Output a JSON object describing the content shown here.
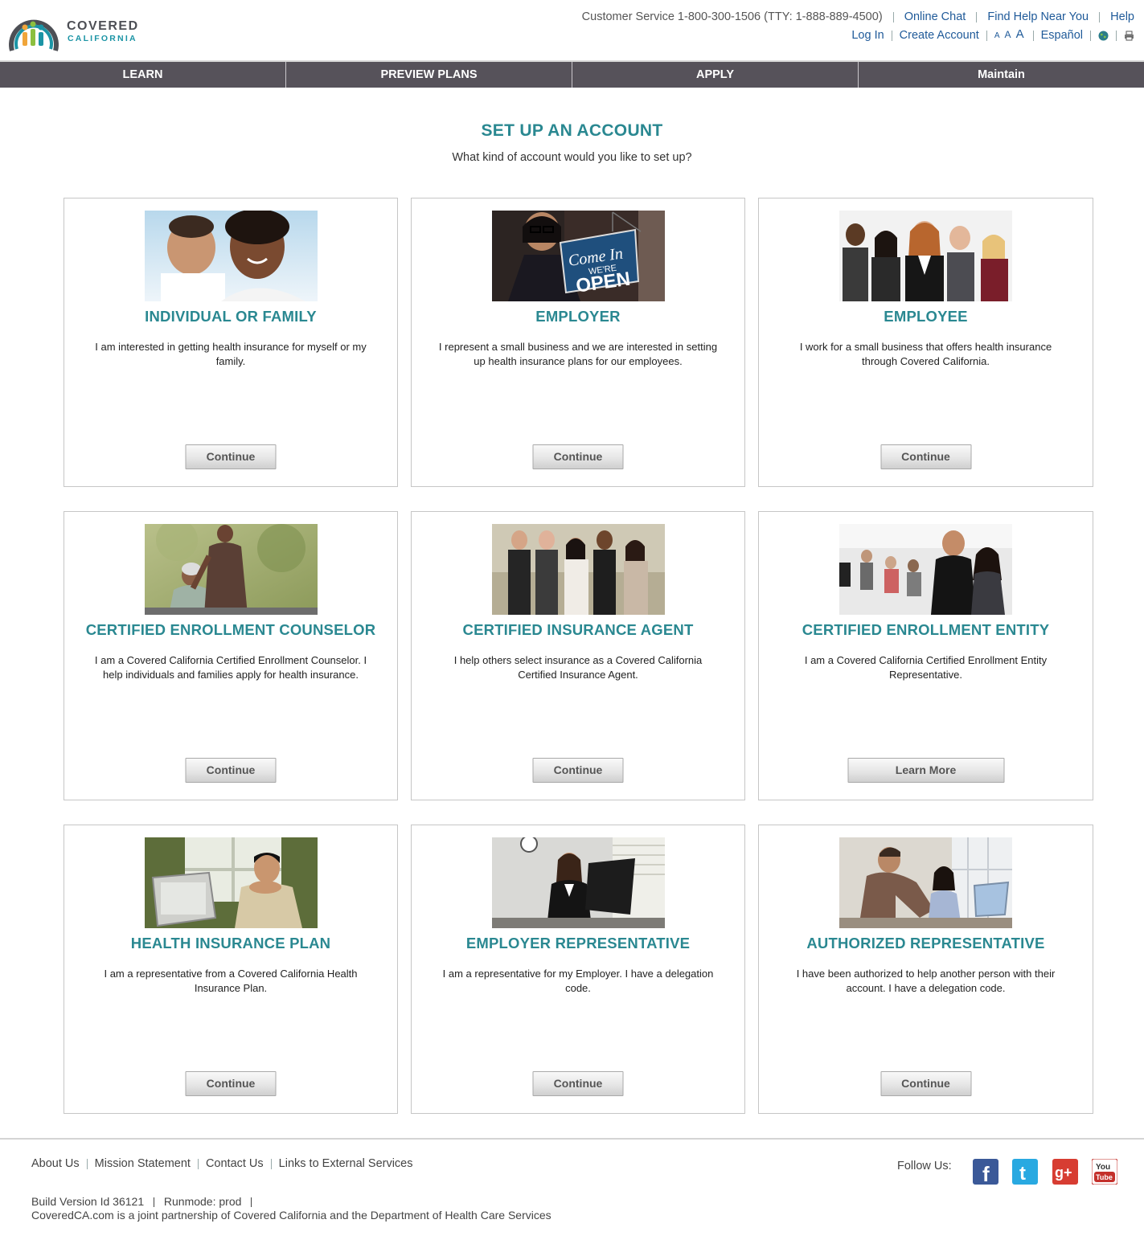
{
  "logo": {
    "line1": "COVERED",
    "line2": "CALIFORNIA"
  },
  "utility": {
    "customer_service": "Customer Service 1-800-300-1506 (TTY: 1-888-889-4500)",
    "online_chat": "Online Chat",
    "find_help": "Find Help Near You",
    "help": "Help",
    "log_in": "Log In",
    "create_account": "Create Account",
    "text_size_small": "A",
    "text_size_medium": "A",
    "text_size_large": "A",
    "espanol": "Español"
  },
  "nav": {
    "items": [
      {
        "label": "LEARN"
      },
      {
        "label": "PREVIEW PLANS"
      },
      {
        "label": "APPLY"
      },
      {
        "label": "Maintain"
      }
    ]
  },
  "page": {
    "title": "SET UP AN ACCOUNT",
    "subtitle": "What kind of account would you like to set up?"
  },
  "cards": [
    {
      "title": "INDIVIDUAL OR FAMILY",
      "description": "I am interested in getting health insurance for myself or my family.",
      "button": "Continue"
    },
    {
      "title": "EMPLOYER",
      "description": "I represent a small business and we are interested in setting up health insurance plans for our employees.",
      "button": "Continue"
    },
    {
      "title": "EMPLOYEE",
      "description": "I work for a small business that offers health insurance through Covered California.",
      "button": "Continue"
    },
    {
      "title": "CERTIFIED ENROLLMENT COUNSELOR",
      "description": "I am a Covered California Certified Enrollment Counselor. I help individuals and families apply for health insurance.",
      "button": "Continue"
    },
    {
      "title": "CERTIFIED INSURANCE AGENT",
      "description": "I help others select insurance as a Covered California Certified Insurance Agent.",
      "button": "Continue"
    },
    {
      "title": "CERTIFIED ENROLLMENT ENTITY",
      "description": "I am a Covered California Certified Enrollment Entity Representative.",
      "button": "Learn More"
    },
    {
      "title": "HEALTH INSURANCE PLAN",
      "description": "I am a representative from a Covered California Health Insurance Plan.",
      "button": "Continue"
    },
    {
      "title": "EMPLOYER REPRESENTATIVE",
      "description": "I am a representative for my Employer. I have a delegation code.",
      "button": "Continue"
    },
    {
      "title": "AUTHORIZED REPRESENTATIVE",
      "description": "I have been authorized to help another person with their account. I have a delegation code.",
      "button": "Continue"
    }
  ],
  "employer_sign": {
    "line1": "Come In",
    "line2": "WE'RE",
    "line3": "OPEN"
  },
  "footer": {
    "links": [
      "About Us",
      "Mission Statement",
      "Contact Us",
      "Links to External Services"
    ],
    "follow_us": "Follow Us:",
    "social": [
      {
        "icon": "facebook-icon",
        "glyph": "f",
        "color": "#3b5998"
      },
      {
        "icon": "twitter-icon",
        "glyph": "t",
        "color": "#29a9e1"
      },
      {
        "icon": "google-plus-icon",
        "glyph": "g+",
        "color": "#d73d32"
      },
      {
        "icon": "youtube-icon",
        "glyph_top": "You",
        "glyph_bottom": "Tube",
        "color": "#c4302b"
      }
    ],
    "build_version": "Build Version Id 36121",
    "runmode": "Runmode: prod",
    "partnership": "CoveredCA.com is a joint partnership of Covered California and the Department of Health Care Services"
  },
  "colors": {
    "teal": "#2a8891",
    "nav_bg": "#56525a",
    "link_blue": "#1f5a99"
  }
}
